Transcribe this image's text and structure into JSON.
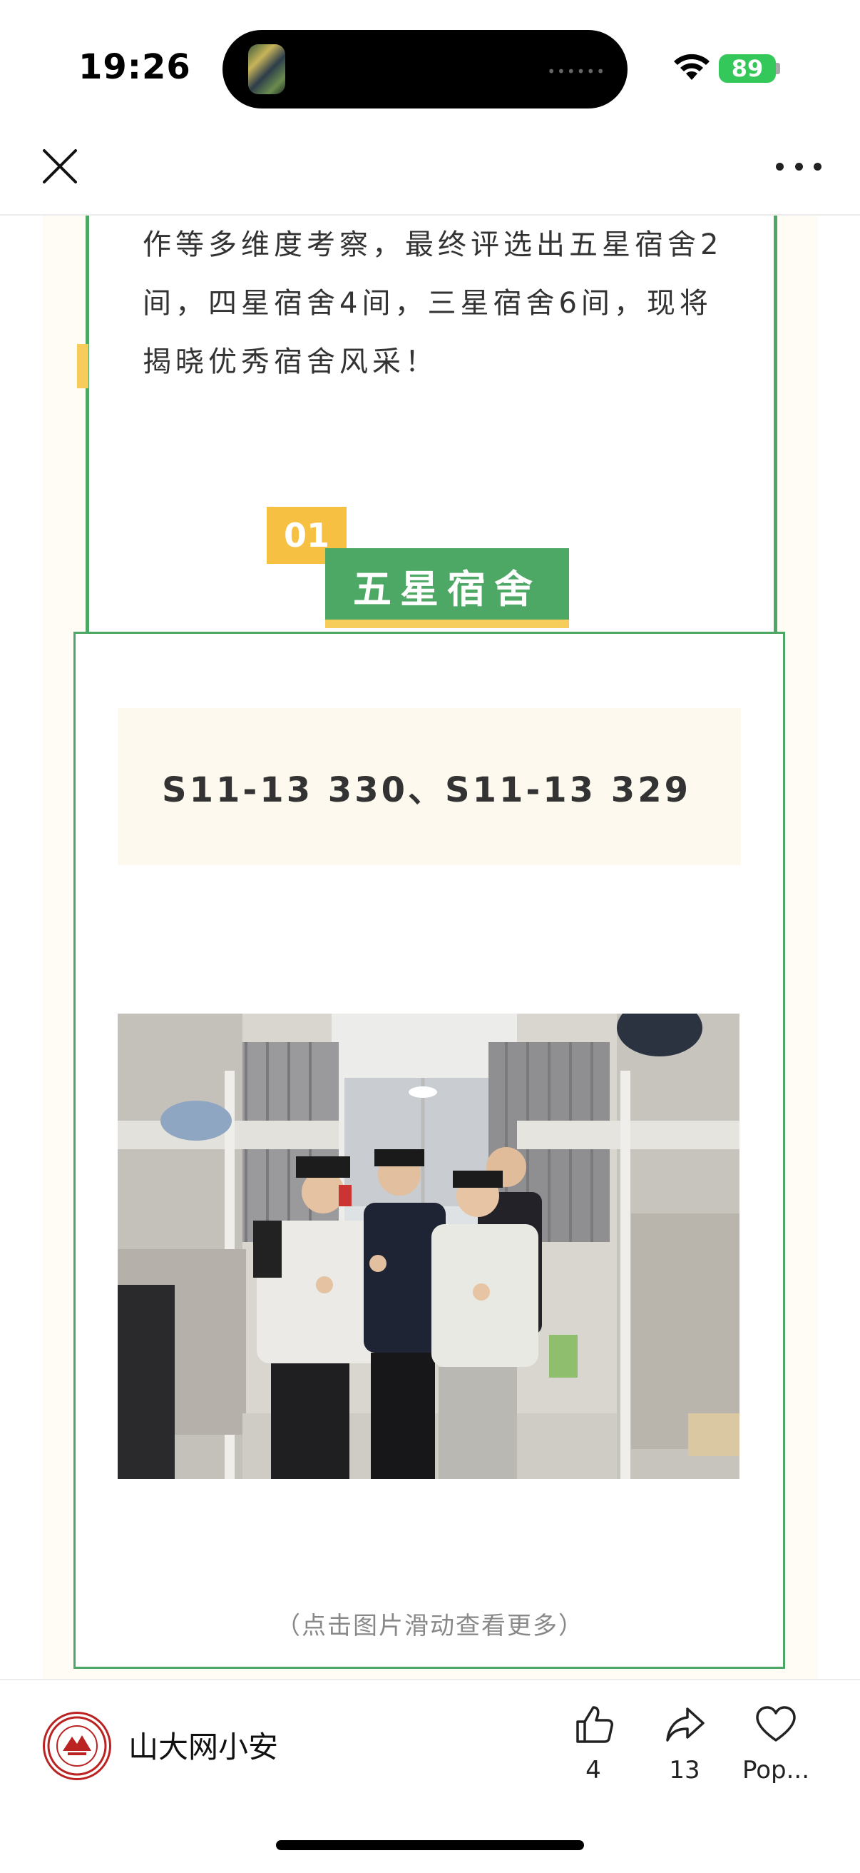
{
  "status_bar": {
    "time": "19:26",
    "battery": "89",
    "icons": [
      "wifi-icon",
      "battery-icon"
    ]
  },
  "nav": {
    "close_icon": "close-icon",
    "more_icon": "more-icon"
  },
  "article": {
    "intro_lines": [
      "作等多维度考察，最终评选出五星宿舍2",
      "间，四星宿舍4间，三星宿舍6间，现将",
      "揭晓优秀宿舍风采！"
    ],
    "section": {
      "number": "01",
      "title": "五星宿舍",
      "rooms": "S11-13 330、S11-13 329",
      "photo_hint": "（点击图片滑动查看更多）"
    }
  },
  "bottom_bar": {
    "account_name": "山大网小安",
    "like_count": "4",
    "share_count": "13",
    "favorite_label": "Pop..."
  },
  "colors": {
    "accent_green": "#4ea865",
    "accent_yellow": "#f6c043",
    "cream": "#fefcf5"
  }
}
